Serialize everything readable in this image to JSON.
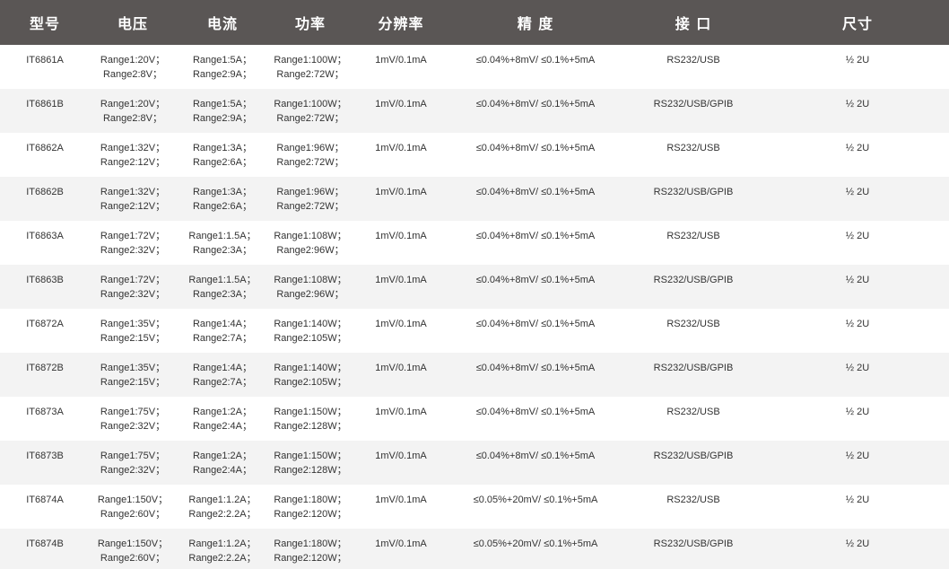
{
  "table": {
    "headers": [
      "型号",
      "电压",
      "电流",
      "功率",
      "分辨率",
      "精 度",
      "接 口",
      "尺寸"
    ],
    "rows": [
      {
        "model": "IT6861A",
        "voltage": [
          "Range1:20V；",
          "Range2:8V；"
        ],
        "current": [
          "Range1:5A；",
          "Range2:9A；"
        ],
        "power": [
          "Range1:100W；",
          "Range2:72W；"
        ],
        "resolution": "1mV/0.1mA",
        "accuracy": "≤0.04%+8mV/ ≤0.1%+5mA",
        "interface": "RS232/USB",
        "size": "½ 2U"
      },
      {
        "model": "IT6861B",
        "voltage": [
          "Range1:20V；",
          "Range2:8V；"
        ],
        "current": [
          "Range1:5A；",
          "Range2:9A；"
        ],
        "power": [
          "Range1:100W；",
          "Range2:72W；"
        ],
        "resolution": "1mV/0.1mA",
        "accuracy": "≤0.04%+8mV/ ≤0.1%+5mA",
        "interface": "RS232/USB/GPIB",
        "size": "½ 2U"
      },
      {
        "model": "IT6862A",
        "voltage": [
          "Range1:32V；",
          "Range2:12V；"
        ],
        "current": [
          "Range1:3A；",
          "Range2:6A；"
        ],
        "power": [
          "Range1:96W；",
          "Range2:72W；"
        ],
        "resolution": "1mV/0.1mA",
        "accuracy": "≤0.04%+8mV/ ≤0.1%+5mA",
        "interface": "RS232/USB",
        "size": "½ 2U"
      },
      {
        "model": "IT6862B",
        "voltage": [
          "Range1:32V；",
          "Range2:12V；"
        ],
        "current": [
          "Range1:3A；",
          "Range2:6A；"
        ],
        "power": [
          "Range1:96W；",
          "Range2:72W；"
        ],
        "resolution": "1mV/0.1mA",
        "accuracy": "≤0.04%+8mV/ ≤0.1%+5mA",
        "interface": "RS232/USB/GPIB",
        "size": "½ 2U"
      },
      {
        "model": "IT6863A",
        "voltage": [
          "Range1:72V；",
          "Range2:32V；"
        ],
        "current": [
          "Range1:1.5A；",
          "Range2:3A；"
        ],
        "power": [
          "Range1:108W；",
          "Range2:96W；"
        ],
        "resolution": "1mV/0.1mA",
        "accuracy": "≤0.04%+8mV/ ≤0.1%+5mA",
        "interface": "RS232/USB",
        "size": "½ 2U"
      },
      {
        "model": "IT6863B",
        "voltage": [
          "Range1:72V；",
          "Range2:32V；"
        ],
        "current": [
          "Range1:1.5A；",
          "Range2:3A；"
        ],
        "power": [
          "Range1:108W；",
          "Range2:96W；"
        ],
        "resolution": "1mV/0.1mA",
        "accuracy": "≤0.04%+8mV/ ≤0.1%+5mA",
        "interface": "RS232/USB/GPIB",
        "size": "½ 2U"
      },
      {
        "model": "IT6872A",
        "voltage": [
          "Range1:35V；",
          "Range2:15V；"
        ],
        "current": [
          "Range1:4A；",
          "Range2:7A；"
        ],
        "power": [
          "Range1:140W；",
          "Range2:105W；"
        ],
        "resolution": "1mV/0.1mA",
        "accuracy": "≤0.04%+8mV/ ≤0.1%+5mA",
        "interface": "RS232/USB",
        "size": "½ 2U"
      },
      {
        "model": "IT6872B",
        "voltage": [
          "Range1:35V；",
          "Range2:15V；"
        ],
        "current": [
          "Range1:4A；",
          "Range2:7A；"
        ],
        "power": [
          "Range1:140W；",
          "Range2:105W；"
        ],
        "resolution": "1mV/0.1mA",
        "accuracy": "≤0.04%+8mV/ ≤0.1%+5mA",
        "interface": "RS232/USB/GPIB",
        "size": "½ 2U"
      },
      {
        "model": "IT6873A",
        "voltage": [
          "Range1:75V；",
          "Range2:32V；"
        ],
        "current": [
          "Range1:2A；",
          "Range2:4A；"
        ],
        "power": [
          "Range1:150W；",
          "Range2:128W；"
        ],
        "resolution": "1mV/0.1mA",
        "accuracy": "≤0.04%+8mV/ ≤0.1%+5mA",
        "interface": "RS232/USB",
        "size": "½ 2U"
      },
      {
        "model": "IT6873B",
        "voltage": [
          "Range1:75V；",
          "Range2:32V；"
        ],
        "current": [
          "Range1:2A；",
          "Range2:4A；"
        ],
        "power": [
          "Range1:150W；",
          "Range2:128W；"
        ],
        "resolution": "1mV/0.1mA",
        "accuracy": "≤0.04%+8mV/ ≤0.1%+5mA",
        "interface": "RS232/USB/GPIB",
        "size": "½ 2U"
      },
      {
        "model": "IT6874A",
        "voltage": [
          "Range1:150V；",
          "Range2:60V；"
        ],
        "current": [
          "Range1:1.2A；",
          "Range2:2.2A；"
        ],
        "power": [
          "Range1:180W；",
          "Range2:120W；"
        ],
        "resolution": "1mV/0.1mA",
        "accuracy": "≤0.05%+20mV/ ≤0.1%+5mA",
        "interface": "RS232/USB",
        "size": "½ 2U"
      },
      {
        "model": "IT6874B",
        "voltage": [
          "Range1:150V；",
          "Range2:60V；"
        ],
        "current": [
          "Range1:1.2A；",
          "Range2:2.2A；"
        ],
        "power": [
          "Range1:180W；",
          "Range2:120W；"
        ],
        "resolution": "1mV/0.1mA",
        "accuracy": "≤0.05%+20mV/ ≤0.1%+5mA",
        "interface": "RS232/USB/GPIB",
        "size": "½ 2U"
      }
    ]
  },
  "colors": {
    "header_bg": "#5a5655",
    "header_text": "#ffffff",
    "row_alt_bg": "#f3f3f3",
    "body_text": "#333333"
  }
}
